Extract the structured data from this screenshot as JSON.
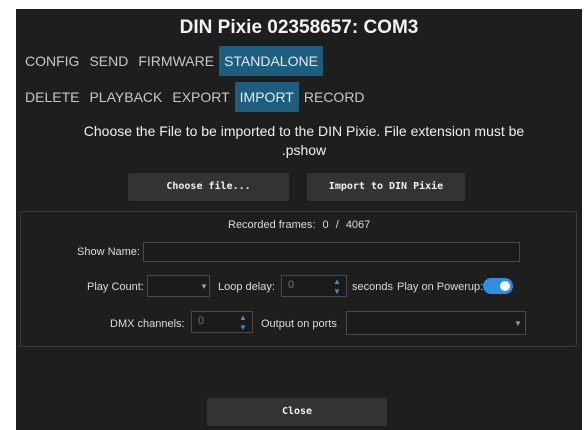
{
  "window": {
    "title": "DIN Pixie 02358657: COM3"
  },
  "main_tabs": [
    {
      "label": "CONFIG",
      "active": false
    },
    {
      "label": "SEND",
      "active": false
    },
    {
      "label": "FIRMWARE",
      "active": false
    },
    {
      "label": "STANDALONE",
      "active": true
    }
  ],
  "sub_tabs": [
    {
      "label": "DELETE",
      "active": false
    },
    {
      "label": "PLAYBACK",
      "active": false
    },
    {
      "label": "EXPORT",
      "active": false
    },
    {
      "label": "IMPORT",
      "active": true
    },
    {
      "label": "RECORD",
      "active": false
    }
  ],
  "instructions": "Choose the File to be imported to the DIN Pixie. File extension must be .pshow",
  "buttons": {
    "choose_file": "Choose file...",
    "import": "Import to DIN Pixie",
    "close": "Close"
  },
  "recorded": {
    "label": "Recorded frames:",
    "current": "0",
    "separator": "/",
    "total": "4067"
  },
  "show_name": {
    "label": "Show Name:",
    "value": ""
  },
  "play_count": {
    "label": "Play Count:",
    "value": ""
  },
  "loop_delay": {
    "label": "Loop delay:",
    "value": "0",
    "unit": "seconds"
  },
  "play_on_powerup": {
    "label": "Play on Powerup:",
    "enabled": true
  },
  "dmx_channels": {
    "label": "DMX channels:",
    "value": "0"
  },
  "output_ports": {
    "label": "Output on ports",
    "value": ""
  },
  "colors": {
    "background": "#1e1e1e",
    "active_tab": "#1d5e80",
    "button": "#333333",
    "toggle_on": "#2f8de4"
  }
}
